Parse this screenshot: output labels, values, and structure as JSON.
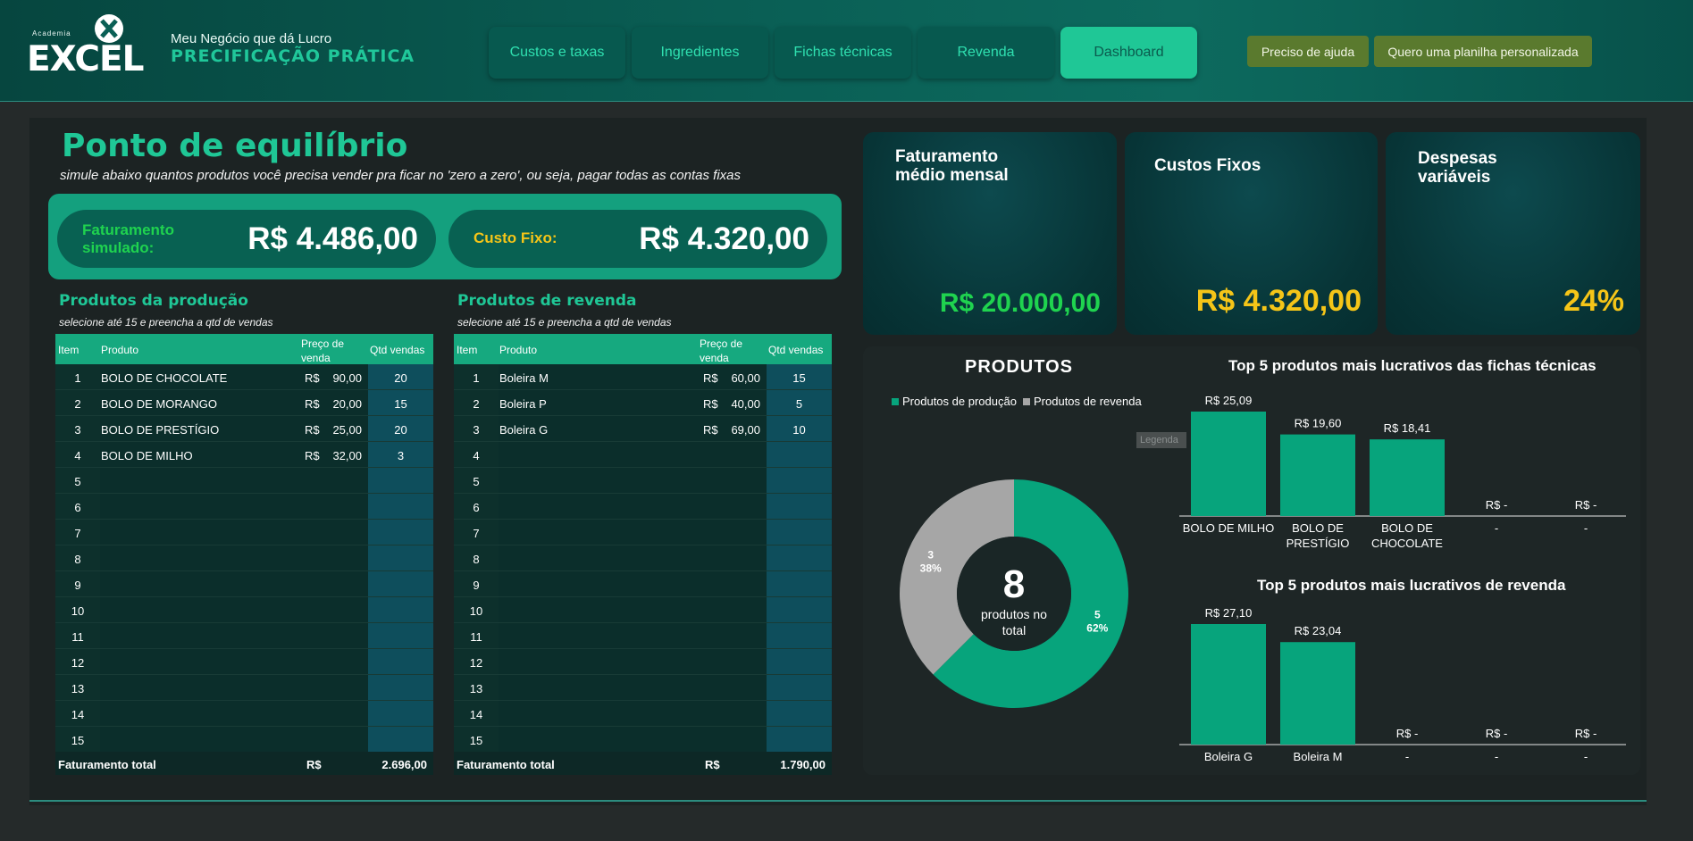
{
  "header": {
    "logo_small": "Academia",
    "logo_big": "EXCEL",
    "subtitle": "Meu Negócio que dá Lucro",
    "title": "PRECIFICAÇÃO PRÁTICA",
    "nav": [
      {
        "label": "Custos e taxas",
        "active": false
      },
      {
        "label": "Ingredientes",
        "active": false
      },
      {
        "label": "Fichas técnicas",
        "active": false
      },
      {
        "label": "Revenda",
        "active": false
      },
      {
        "label": "Dashboard",
        "active": true
      }
    ],
    "help_label": "Preciso de ajuda",
    "custom_label": "Quero uma planilha personalizada"
  },
  "breakeven": {
    "title": "Ponto de equilíbrio",
    "subtitle": "simule abaixo quantos produtos você precisa vender pra ficar no 'zero a zero', ou seja, pagar todas as contas fixas",
    "sim_label": "Faturamento simulado:",
    "sim_value": "R$ 4.486,00",
    "fixed_label": "Custo Fixo:",
    "fixed_value": "R$ 4.320,00"
  },
  "production_table": {
    "title": "Produtos da produção",
    "subtitle": "selecione até 15 e preencha a qtd de vendas",
    "headers": {
      "item": "Item",
      "produto": "Produto",
      "preco": "Preço de venda",
      "qtd": "Qtd vendas"
    },
    "rows": [
      {
        "item": "1",
        "produto": "BOLO DE CHOCOLATE",
        "cur": "R$",
        "preco": "90,00",
        "qtd": "20"
      },
      {
        "item": "2",
        "produto": "BOLO DE MORANGO",
        "cur": "R$",
        "preco": "20,00",
        "qtd": "15"
      },
      {
        "item": "3",
        "produto": "BOLO DE PRESTÍGIO",
        "cur": "R$",
        "preco": "25,00",
        "qtd": "20"
      },
      {
        "item": "4",
        "produto": "BOLO DE MILHO",
        "cur": "R$",
        "preco": "32,00",
        "qtd": "3"
      },
      {
        "item": "5",
        "produto": "",
        "cur": "",
        "preco": "",
        "qtd": ""
      },
      {
        "item": "6",
        "produto": "",
        "cur": "",
        "preco": "",
        "qtd": ""
      },
      {
        "item": "7",
        "produto": "",
        "cur": "",
        "preco": "",
        "qtd": ""
      },
      {
        "item": "8",
        "produto": "",
        "cur": "",
        "preco": "",
        "qtd": ""
      },
      {
        "item": "9",
        "produto": "",
        "cur": "",
        "preco": "",
        "qtd": ""
      },
      {
        "item": "10",
        "produto": "",
        "cur": "",
        "preco": "",
        "qtd": ""
      },
      {
        "item": "11",
        "produto": "",
        "cur": "",
        "preco": "",
        "qtd": ""
      },
      {
        "item": "12",
        "produto": "",
        "cur": "",
        "preco": "",
        "qtd": ""
      },
      {
        "item": "13",
        "produto": "",
        "cur": "",
        "preco": "",
        "qtd": ""
      },
      {
        "item": "14",
        "produto": "",
        "cur": "",
        "preco": "",
        "qtd": ""
      },
      {
        "item": "15",
        "produto": "",
        "cur": "",
        "preco": "",
        "qtd": ""
      }
    ],
    "footer_label": "Faturamento total",
    "footer_cur": "R$",
    "footer_value": "2.696,00"
  },
  "resale_table": {
    "title": "Produtos de revenda",
    "subtitle": "selecione até 15 e preencha a qtd de vendas",
    "headers": {
      "item": "Item",
      "produto": "Produto",
      "preco": "Preço de venda",
      "qtd": "Qtd vendas"
    },
    "rows": [
      {
        "item": "1",
        "produto": "Boleira M",
        "cur": "R$",
        "preco": "60,00",
        "qtd": "15"
      },
      {
        "item": "2",
        "produto": "Boleira P",
        "cur": "R$",
        "preco": "40,00",
        "qtd": "5"
      },
      {
        "item": "3",
        "produto": "Boleira G",
        "cur": "R$",
        "preco": "69,00",
        "qtd": "10"
      },
      {
        "item": "4",
        "produto": "",
        "cur": "",
        "preco": "",
        "qtd": ""
      },
      {
        "item": "5",
        "produto": "",
        "cur": "",
        "preco": "",
        "qtd": ""
      },
      {
        "item": "6",
        "produto": "",
        "cur": "",
        "preco": "",
        "qtd": ""
      },
      {
        "item": "7",
        "produto": "",
        "cur": "",
        "preco": "",
        "qtd": ""
      },
      {
        "item": "8",
        "produto": "",
        "cur": "",
        "preco": "",
        "qtd": ""
      },
      {
        "item": "9",
        "produto": "",
        "cur": "",
        "preco": "",
        "qtd": ""
      },
      {
        "item": "10",
        "produto": "",
        "cur": "",
        "preco": "",
        "qtd": ""
      },
      {
        "item": "11",
        "produto": "",
        "cur": "",
        "preco": "",
        "qtd": ""
      },
      {
        "item": "12",
        "produto": "",
        "cur": "",
        "preco": "",
        "qtd": ""
      },
      {
        "item": "13",
        "produto": "",
        "cur": "",
        "preco": "",
        "qtd": ""
      },
      {
        "item": "14",
        "produto": "",
        "cur": "",
        "preco": "",
        "qtd": ""
      },
      {
        "item": "15",
        "produto": "",
        "cur": "",
        "preco": "",
        "qtd": ""
      }
    ],
    "footer_label": "Faturamento total",
    "footer_cur": "R$",
    "footer_value": "1.790,00"
  },
  "kpis": [
    {
      "title": "Faturamento médio mensal",
      "value": "R$ 20.000,00",
      "color": "#1fd34f"
    },
    {
      "title": "Custos Fixos",
      "value": "R$ 4.320,00",
      "color": "#f5c518"
    },
    {
      "title": "Despesas variáveis",
      "value": "24%",
      "color": "#f5c518"
    }
  ],
  "colors": {
    "accent": "#1fc796",
    "resale": "#a6a6a6",
    "bar": "#07a47c"
  },
  "chart_data": [
    {
      "type": "pie",
      "title": "PRODUTOS",
      "legend": [
        "Produtos de produção",
        "Produtos de revenda"
      ],
      "legend_tag": "Legenda",
      "slices": [
        {
          "name": "Produtos de produção",
          "value": 5,
          "label_value": "5",
          "label_pct": "62%",
          "color": "#07a47c"
        },
        {
          "name": "Produtos de revenda",
          "value": 3,
          "label_value": "3",
          "label_pct": "38%",
          "color": "#a6a6a6"
        }
      ],
      "center_value": "8",
      "center_label": "produtos no total"
    },
    {
      "type": "bar",
      "title": "Top 5 produtos mais lucrativos das fichas técnicas",
      "categories": [
        "BOLO DE MILHO",
        "BOLO DE PRESTÍGIO",
        "BOLO DE CHOCOLATE",
        "-",
        "-"
      ],
      "values": [
        25.09,
        19.6,
        18.41,
        0,
        0
      ],
      "labels": [
        "R$ 25,09",
        "R$ 19,60",
        "R$ 18,41",
        "R$ -",
        "R$ -"
      ],
      "ylim": [
        0,
        25.09
      ]
    },
    {
      "type": "bar",
      "title": "Top 5 produtos mais lucrativos de revenda",
      "categories": [
        "Boleira G",
        "Boleira M",
        "-",
        "-",
        "-"
      ],
      "values": [
        27.1,
        23.04,
        0,
        0,
        0
      ],
      "labels": [
        "R$ 27,10",
        "R$ 23,04",
        "R$ -",
        "R$ -",
        "R$ -"
      ],
      "ylim": [
        0,
        27.1
      ]
    }
  ]
}
